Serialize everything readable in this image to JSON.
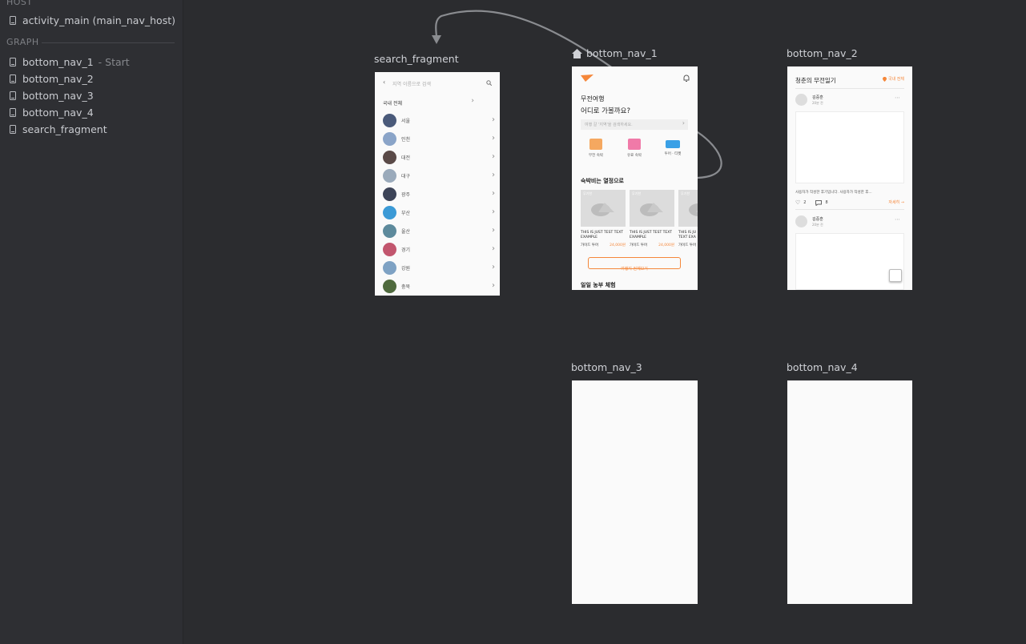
{
  "sidebar": {
    "host_label": "HOST",
    "host_item": "activity_main (main_nav_host)",
    "graph_label": "GRAPH",
    "items": [
      {
        "label": "bottom_nav_1",
        "suffix": "- Start"
      },
      {
        "label": "bottom_nav_2",
        "suffix": ""
      },
      {
        "label": "bottom_nav_3",
        "suffix": ""
      },
      {
        "label": "bottom_nav_4",
        "suffix": ""
      },
      {
        "label": "search_fragment",
        "suffix": ""
      }
    ]
  },
  "destinations": {
    "search_fragment": {
      "label": "search_fragment",
      "search_placeholder": "지역 이름으로 검색",
      "all_label": "국내 전체",
      "regions": [
        "서울",
        "인천",
        "대전",
        "대구",
        "광주",
        "부산",
        "울산",
        "경기",
        "강원",
        "충북"
      ]
    },
    "bottom_nav_1": {
      "label": "bottom_nav_1",
      "title_line1": "무전여행",
      "title_line2": "어디로 가볼까요?",
      "search_placeholder": "여행 갈 '지역'을 검색하세요.",
      "categories": [
        "무전 숙박",
        "유료 숙박",
        "투어 · 티켓"
      ],
      "section_title": "숙박비는 열정으로",
      "cards": [
        {
          "tag": "무기한",
          "title": "THIS IS JUST TEST TEXT EXAMPLE",
          "type": "가이드 투어",
          "price": "24,000원"
        },
        {
          "tag": "무기한",
          "title": "THIS IS JUST TEST TEXT EXAMPLE",
          "type": "가이드 투어",
          "price": "24,000원"
        },
        {
          "tag": "무기한",
          "title": "THIS IS JU TEXT EXA",
          "type": "가이드 투어",
          "price": ""
        }
      ],
      "view_all": "여행지 전체보기",
      "section2_title": "일일 농부 체험"
    },
    "bottom_nav_2": {
      "label": "bottom_nav_2",
      "title": "청춘의 무전일기",
      "region": "국내 전체",
      "post1_user": "김중훈",
      "post1_time": "20분 전",
      "post1_text": "사용자가 작성한 후기입니다. 사용자가 작성한 후...",
      "likes": "2",
      "comments": "8",
      "more": "자세히",
      "post2_user": "김중훈",
      "post2_time": "20분 전"
    },
    "bottom_nav_3": {
      "label": "bottom_nav_3"
    },
    "bottom_nav_4": {
      "label": "bottom_nav_4"
    }
  },
  "colors": {
    "accent": "#f5873a",
    "canvas": "#2b2c2f",
    "sidebar": "#2e2f33"
  }
}
